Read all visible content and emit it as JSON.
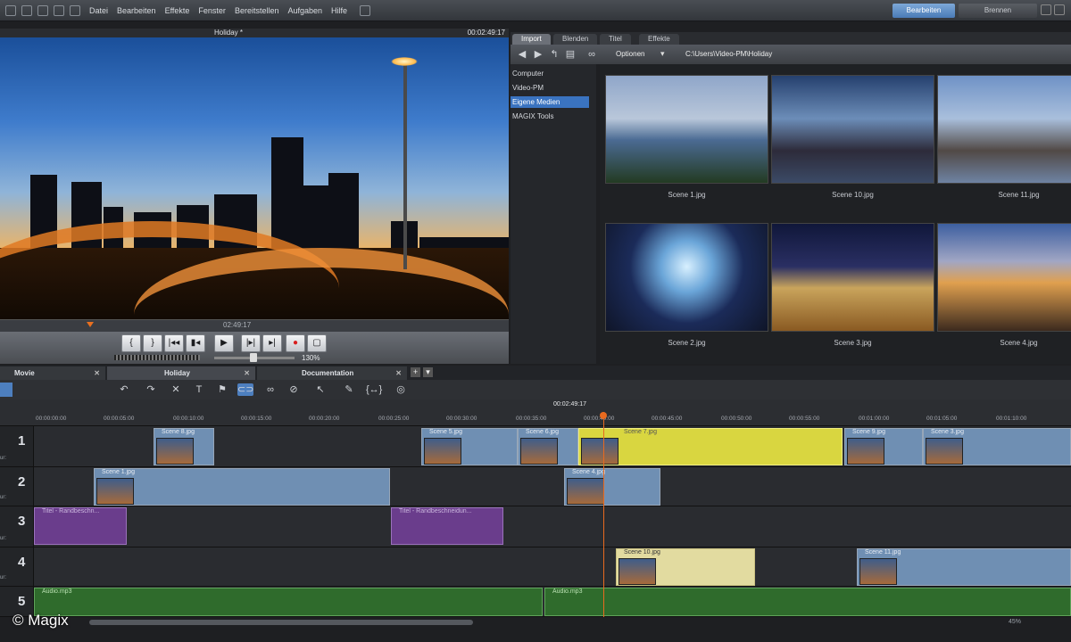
{
  "menu": {
    "items": [
      "Datei",
      "Bearbeiten",
      "Effekte",
      "Fenster",
      "Bereitstellen",
      "Aufgaben",
      "Hilfe"
    ],
    "mode_edit": "Bearbeiten",
    "mode_burn": "Brennen"
  },
  "preview": {
    "title": "Holiday *",
    "timecode": "00:02:49:17",
    "scrub_timecode": "02:49:17",
    "zoom": "130%",
    "transport": [
      "{",
      "}",
      "|◂◂",
      "▮◂",
      "▶",
      "|▸|",
      "▸|",
      "●",
      "▢"
    ]
  },
  "pool": {
    "tabs": [
      "Import",
      "Blenden",
      "Titel",
      "Effekte"
    ],
    "active_tab": "Import",
    "options_label": "Optionen",
    "path": "C:\\Users\\Video-PM\\Holiday",
    "nav": [
      "Computer",
      "Video-PM",
      "Eigene Medien",
      "MAGIX Tools"
    ],
    "nav_selected": "Eigene Medien",
    "thumbs": [
      {
        "label": "Scene 1.jpg"
      },
      {
        "label": "Scene 10.jpg"
      },
      {
        "label": "Scene 11.jpg"
      },
      {
        "label": "Scene 2.jpg"
      },
      {
        "label": "Scene 3.jpg"
      },
      {
        "label": "Scene 4.jpg"
      }
    ]
  },
  "project_tabs": [
    "Movie",
    "Holiday",
    "Documentation"
  ],
  "timeline": {
    "timecode": "00:02:49:17",
    "ticks": [
      "00:00:00:00",
      "00:00:05:00",
      "00:00:10:00",
      "00:00:15:00",
      "00:00:20:00",
      "00:00:25:00",
      "00:00:30:00",
      "00:00:35:00",
      "00:00:40:00",
      "00:00:45:00",
      "00:00:50:00",
      "00:00:55:00",
      "00:01:00:00",
      "00:01:05:00",
      "00:01:10:00"
    ],
    "tracks": [
      "1",
      "2",
      "3",
      "4",
      "5"
    ],
    "track_sub": "ur:",
    "clips": {
      "c1a": "Scene 8.jpg",
      "c1b": "Scene 5.jpg",
      "c1c": "Scene 6.jpg",
      "c1d": "Scene 7.jpg",
      "c1e": "Scene 9.jpg",
      "c1f": "Scene 3.jpg",
      "c2a": "Scene 1.jpg",
      "c2b": "Scene 4.jpg",
      "c3a": "Titel - Randbeschn...",
      "c3b": "Titel - Randbeschneidun...",
      "c4a": "Scene 10.jpg",
      "c4b": "Scene 11.jpg",
      "c5a": "Audio.mp3",
      "c5b": "Audio.mp3"
    },
    "zoom_status": "45%"
  },
  "watermark": "© Magix",
  "colors": {
    "accent": "#3a73c0",
    "playhead": "#e86a1f",
    "video_clip": "#6f8fb3",
    "selected_clip": "#d9d640",
    "title_clip": "#6a3d8c",
    "audio_clip": "#2f6b2c"
  }
}
